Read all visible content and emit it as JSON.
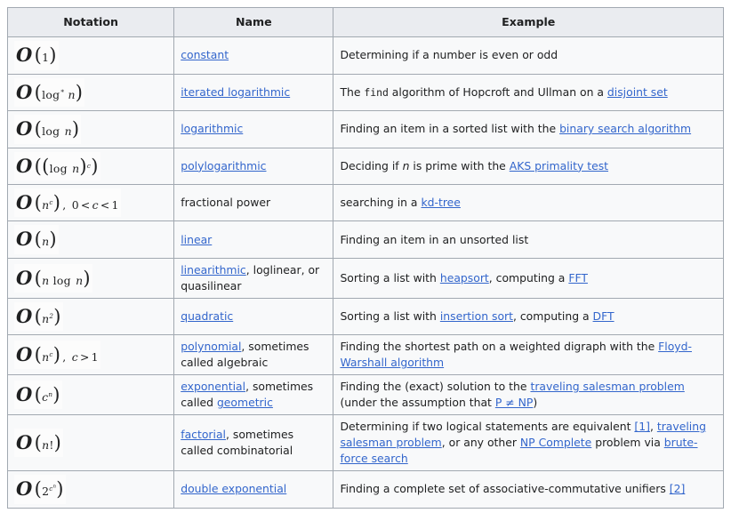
{
  "table": {
    "headers": [
      "Notation",
      "Name",
      "Example"
    ],
    "rows": [
      {
        "notation_plain": "O(1)",
        "name_parts": [
          {
            "t": "constant",
            "link": true
          }
        ],
        "example_parts": [
          {
            "t": "Determining if a number is even or odd",
            "link": false
          }
        ]
      },
      {
        "notation_plain": "O(log* n)",
        "name_parts": [
          {
            "t": "iterated logarithmic",
            "link": true
          }
        ],
        "example_parts": [
          {
            "t": "The ",
            "link": false
          },
          {
            "t": "find",
            "link": false,
            "mono": true
          },
          {
            "t": " algorithm of Hopcroft and Ullman on a ",
            "link": false
          },
          {
            "t": "disjoint set",
            "link": true
          }
        ]
      },
      {
        "notation_plain": "O(log n)",
        "name_parts": [
          {
            "t": "logarithmic",
            "link": true
          }
        ],
        "example_parts": [
          {
            "t": "Finding an item in a sorted list with the ",
            "link": false
          },
          {
            "t": "binary search algorithm",
            "link": true
          }
        ]
      },
      {
        "notation_plain": "O((log n)^c)",
        "name_parts": [
          {
            "t": "polylogarithmic",
            "link": true
          }
        ],
        "example_parts": [
          {
            "t": "Deciding if ",
            "link": false
          },
          {
            "t": "n",
            "link": false,
            "italic": true
          },
          {
            "t": " is prime with the ",
            "link": false
          },
          {
            "t": "AKS primality test",
            "link": true
          }
        ]
      },
      {
        "notation_plain": "O(n^c), 0 < c < 1",
        "name_parts": [
          {
            "t": "fractional power",
            "link": false
          }
        ],
        "example_parts": [
          {
            "t": "searching in a ",
            "link": false
          },
          {
            "t": "kd-tree",
            "link": true
          }
        ]
      },
      {
        "notation_plain": "O(n)",
        "name_parts": [
          {
            "t": "linear",
            "link": true
          }
        ],
        "example_parts": [
          {
            "t": "Finding an item in an unsorted list",
            "link": false
          }
        ]
      },
      {
        "notation_plain": "O(n log n)",
        "name_parts": [
          {
            "t": "linearithmic",
            "link": true
          },
          {
            "t": ", loglinear, or quasilinear",
            "link": false
          }
        ],
        "example_parts": [
          {
            "t": "Sorting a list with ",
            "link": false
          },
          {
            "t": "heapsort",
            "link": true
          },
          {
            "t": ", computing a ",
            "link": false
          },
          {
            "t": "FFT",
            "link": true
          }
        ]
      },
      {
        "notation_plain": "O(n^2)",
        "name_parts": [
          {
            "t": "quadratic",
            "link": true
          }
        ],
        "example_parts": [
          {
            "t": "Sorting a list with ",
            "link": false
          },
          {
            "t": "insertion sort",
            "link": true
          },
          {
            "t": ", computing a ",
            "link": false
          },
          {
            "t": "DFT",
            "link": true
          }
        ]
      },
      {
        "notation_plain": "O(n^c), c > 1",
        "name_parts": [
          {
            "t": "polynomial",
            "link": true
          },
          {
            "t": ", sometimes called algebraic",
            "link": false
          }
        ],
        "example_parts": [
          {
            "t": "Finding the shortest path on a weighted digraph with the ",
            "link": false
          },
          {
            "t": "Floyd-Warshall algorithm",
            "link": true
          }
        ]
      },
      {
        "notation_plain": "O(c^n)",
        "name_parts": [
          {
            "t": "exponential",
            "link": true
          },
          {
            "t": ", sometimes called ",
            "link": false
          },
          {
            "t": "geometric",
            "link": true
          }
        ],
        "example_parts": [
          {
            "t": "Finding the (exact) solution to the ",
            "link": false
          },
          {
            "t": "traveling salesman problem",
            "link": true
          },
          {
            "t": " (under the assumption that ",
            "link": false
          },
          {
            "t": "P ≠ NP",
            "link": true
          },
          {
            "t": ")",
            "link": false
          }
        ]
      },
      {
        "notation_plain": "O(n!)",
        "name_parts": [
          {
            "t": "factorial",
            "link": true
          },
          {
            "t": ", sometimes called combinatorial",
            "link": false
          }
        ],
        "example_parts": [
          {
            "t": "Determining if two logical statements are equivalent ",
            "link": false
          },
          {
            "t": "[1]",
            "link": true
          },
          {
            "t": ", ",
            "link": false
          },
          {
            "t": "traveling salesman problem",
            "link": true
          },
          {
            "t": ", or any other ",
            "link": false
          },
          {
            "t": "NP Complete",
            "link": true
          },
          {
            "t": " problem via ",
            "link": false
          },
          {
            "t": "brute-force search",
            "link": true
          }
        ]
      },
      {
        "notation_plain": "O(2^(c^n))",
        "name_parts": [
          {
            "t": "double exponential",
            "link": true
          }
        ],
        "example_parts": [
          {
            "t": "Finding a complete set of associative-commutative unifiers ",
            "link": false
          },
          {
            "t": "[2]",
            "link": true
          }
        ]
      }
    ]
  },
  "colors": {
    "link": "#3366cc",
    "header_bg": "#eaecf0",
    "cell_bg": "#f8f9fa",
    "border": "#a2a9b1",
    "text": "#202122"
  }
}
